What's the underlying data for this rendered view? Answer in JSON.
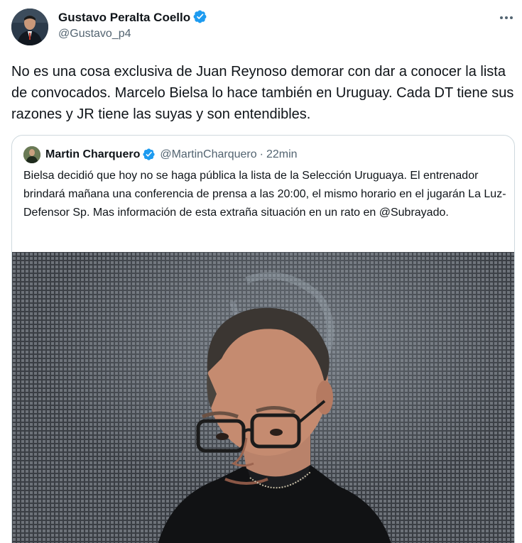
{
  "author": {
    "name": "Gustavo Peralta Coello",
    "handle": "@Gustavo_p4"
  },
  "tweet": {
    "text": "No es una cosa exclusiva de Juan Reynoso demorar con dar a conocer la lista de convocados. Marcelo Bielsa lo hace también en Uruguay. Cada DT tiene sus razones y JR tiene las suyas y son entendibles."
  },
  "quoted": {
    "name": "Martin Charquero",
    "handle": "@MartinCharquero",
    "separator": "·",
    "time": "22min",
    "text": "Bielsa decidió que hoy no se haga pública la lista de la Selección Uruguaya. El entrenador brindará mañana una conferencia de prensa a las 20:00, el mismo horario en el jugarán La Luz-Defensor Sp. Mas información de esta extraña situación en un rato en @Subrayado."
  },
  "icons": {
    "verified": "verified-badge-icon",
    "more": "more-options-icon"
  },
  "colors": {
    "verified": "#1d9bf0",
    "text": "#0f1419",
    "secondary": "#536471",
    "border": "#cfd9de"
  }
}
